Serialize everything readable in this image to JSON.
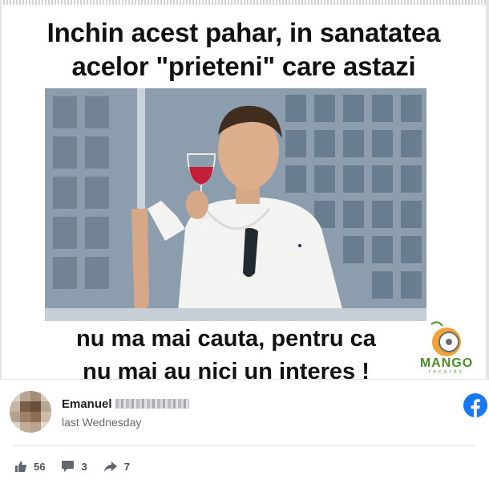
{
  "meme": {
    "headline_line1": "Inchin acest pahar, in sanatatea",
    "headline_line2": "acelor \"prieteni\" care astazi",
    "caption_line1": "nu ma mai cauta, pentru ca",
    "caption_line2": "nu mai au nici un interes !",
    "logo_text": "MANGO",
    "logo_subtext": "records"
  },
  "post": {
    "author_first_name": "Emanuel",
    "timestamp": "last Wednesday",
    "platform_icon": "facebook-icon",
    "brand_color": "#1877f2"
  },
  "stats": {
    "likes": "56",
    "comments": "3",
    "shares": "7"
  }
}
